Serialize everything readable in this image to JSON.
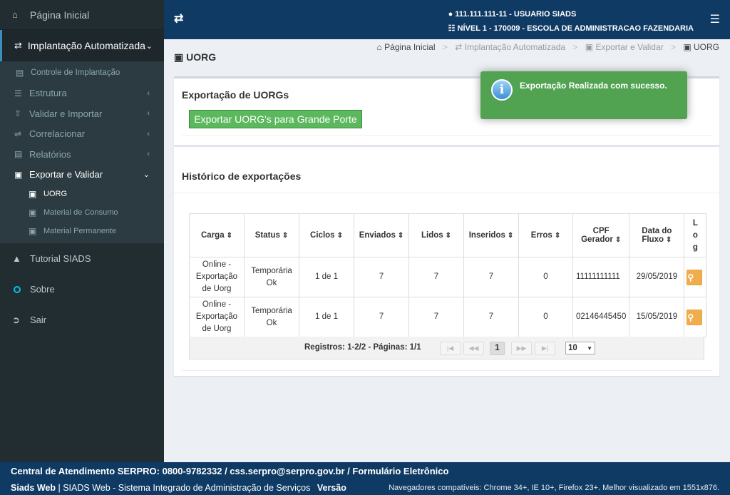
{
  "sidebar": {
    "home": "Página Inicial",
    "section": "Implantação Automatizada",
    "items": [
      {
        "label": "Controle de Implantação"
      },
      {
        "label": "Estrutura"
      },
      {
        "label": "Validar e Importar"
      },
      {
        "label": "Correlacionar"
      },
      {
        "label": "Relatórios"
      },
      {
        "label": "Exportar e Validar"
      }
    ],
    "subitems": [
      {
        "label": "UORG"
      },
      {
        "label": "Material de Consumo"
      },
      {
        "label": "Material Permanente"
      }
    ],
    "tutorial": "Tutorial SIADS",
    "about": "Sobre",
    "logout": "Sair"
  },
  "header": {
    "user": "111.111.111-11 - USUARIO SIADS",
    "level": "NÍVEL 1 - 170009 - ESCOLA DE ADMINISTRACAO FAZENDARIA"
  },
  "page": {
    "title": "UORG",
    "breadcrumb": [
      "Página Inicial",
      "Implantação Automatizada",
      "Exportar e Validar",
      "UORG"
    ]
  },
  "export_section": {
    "title": "Exportação de UORGs",
    "button": "Exportar UORG's para Grande Porte"
  },
  "history": {
    "title": "Histórico de exportações",
    "columns": [
      {
        "l1": "Carga",
        "l2": ""
      },
      {
        "l1": "Status",
        "l2": ""
      },
      {
        "l1": "Ciclos",
        "l2": ""
      },
      {
        "l1": "Enviados",
        "l2": ""
      },
      {
        "l1": "Lidos",
        "l2": ""
      },
      {
        "l1": "Inseridos",
        "l2": ""
      },
      {
        "l1": "Erros",
        "l2": ""
      },
      {
        "l1": "CPF",
        "l2": "Gerador"
      },
      {
        "l1": "Data do",
        "l2": "Fluxo"
      },
      {
        "l1": "Log",
        "l2": ""
      }
    ],
    "rows": [
      {
        "carga": "Online - Exportação de Uorg",
        "status": "Temporária Ok",
        "ciclos": "1 de 1",
        "enviados": "7",
        "lidos": "7",
        "inseridos": "7",
        "erros": "0",
        "cpf": "11111111111",
        "data": "29/05/2019"
      },
      {
        "carga": "Online - Exportação de Uorg",
        "status": "Temporária Ok",
        "ciclos": "1 de 1",
        "enviados": "7",
        "lidos": "7",
        "inseridos": "7",
        "erros": "0",
        "cpf": "02146445450",
        "data": "15/05/2019"
      }
    ],
    "records_info": "Registros: 1-2/2 - Páginas: 1/1",
    "current_page": "1",
    "page_size": "10"
  },
  "toast": {
    "message": "Exportação Realizada com sucesso."
  },
  "footer": {
    "contact": "Central de Atendimento SERPRO: 0800-9782332 / css.serpro@serpro.gov.br / Formulário Eletrônico",
    "brand": "Siads Web",
    "system": "SIADS Web - Sistema Integrado de Administração de Serviços",
    "version": "Versão",
    "browsers": "Navegadores compatíveis: Chrome 34+, IE 10+, Firefox 23+. Melhor visualizado em 1551x876."
  },
  "colors": {
    "header_bg": "#0e3a64",
    "sidebar_bg": "#222d32",
    "success_green": "#5cb85c",
    "toast_green": "#51a351",
    "warning_orange": "#f0ad4e"
  }
}
